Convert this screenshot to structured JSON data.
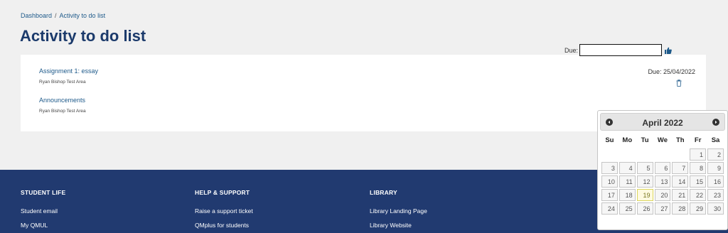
{
  "breadcrumb": {
    "home": "Dashboard",
    "separator": "/",
    "current": "Activity to do list"
  },
  "page_title": "Activity to do list",
  "items": [
    {
      "title": "Assignment 1: essay",
      "course": "Ryan Bishop Test Area",
      "due": "Due: 25/04/2022",
      "action_icon": "trash-icon"
    },
    {
      "title": "Announcements",
      "course": "Ryan Bishop Test Area",
      "due_label": "Due:",
      "due_value": "",
      "action_icon": "thumbs-up-icon"
    }
  ],
  "datepicker": {
    "month_label": "April 2022",
    "weekdays": [
      "Su",
      "Mo",
      "Tu",
      "We",
      "Th",
      "Fr",
      "Sa"
    ],
    "weeks": [
      [
        "",
        "",
        "",
        "",
        "",
        "1",
        "2"
      ],
      [
        "3",
        "4",
        "5",
        "6",
        "7",
        "8",
        "9"
      ],
      [
        "10",
        "11",
        "12",
        "13",
        "14",
        "15",
        "16"
      ],
      [
        "17",
        "18",
        "19",
        "20",
        "21",
        "22",
        "23"
      ],
      [
        "24",
        "25",
        "26",
        "27",
        "28",
        "29",
        "30"
      ]
    ],
    "today": "19"
  },
  "footer": {
    "columns": [
      {
        "heading": "STUDENT LIFE",
        "links": [
          "Student email",
          "My QMUL"
        ]
      },
      {
        "heading": "HELP & SUPPORT",
        "links": [
          "Raise a support ticket",
          "QMplus for students"
        ]
      },
      {
        "heading": "LIBRARY",
        "links": [
          "Library Landing Page",
          "Library Website"
        ]
      }
    ]
  },
  "colors": {
    "footer_bg": "#213a70",
    "title": "#1b3a6b",
    "link": "#1e5a8a",
    "today_highlight": "#fffae0"
  }
}
